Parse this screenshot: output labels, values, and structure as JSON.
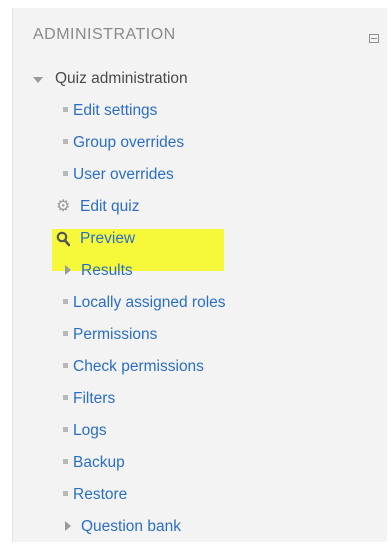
{
  "block": {
    "title": "ADMINISTRATION"
  },
  "tree": {
    "root": {
      "label": "Quiz administration",
      "icon": "chevron-down-icon"
    },
    "items": [
      {
        "label": "Edit settings",
        "icon": "bullet-icon"
      },
      {
        "label": "Group overrides",
        "icon": "bullet-icon"
      },
      {
        "label": "User overrides",
        "icon": "bullet-icon"
      },
      {
        "label": "Edit quiz",
        "icon": "gear-icon"
      },
      {
        "label": "Preview",
        "icon": "search-icon",
        "highlighted": true,
        "highlight_color": "#f5f93a"
      },
      {
        "label": "Results",
        "icon": "chevron-right-icon"
      },
      {
        "label": "Locally assigned roles",
        "icon": "bullet-icon"
      },
      {
        "label": "Permissions",
        "icon": "bullet-icon"
      },
      {
        "label": "Check permissions",
        "icon": "bullet-icon"
      },
      {
        "label": "Filters",
        "icon": "bullet-icon"
      },
      {
        "label": "Logs",
        "icon": "bullet-icon"
      },
      {
        "label": "Backup",
        "icon": "bullet-icon"
      },
      {
        "label": "Restore",
        "icon": "bullet-icon"
      },
      {
        "label": "Question bank",
        "icon": "chevron-right-icon"
      }
    ]
  },
  "colors": {
    "link": "#2a6ec5",
    "root_text": "#4a4a4a",
    "header_text": "#8a8a8a",
    "block_background": "#f3f3f3"
  }
}
